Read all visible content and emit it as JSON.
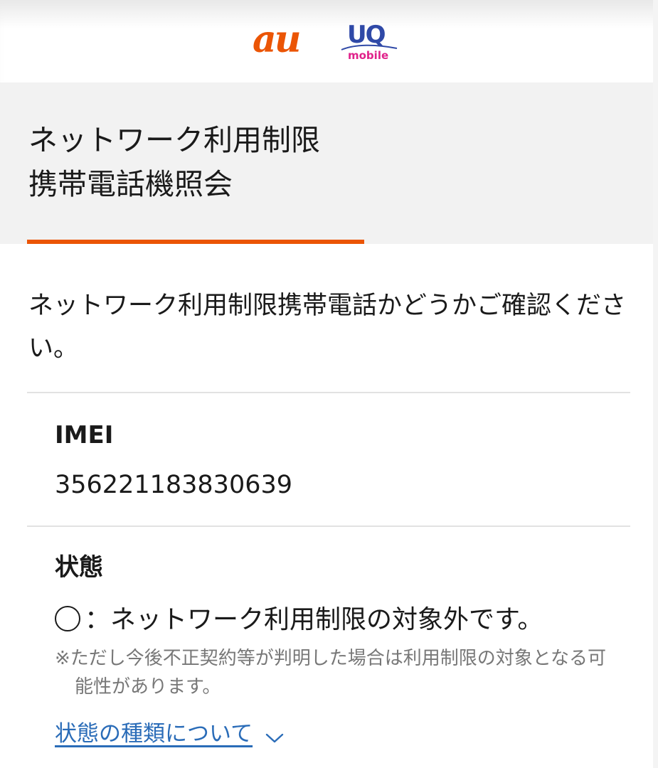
{
  "header": {
    "logo_au": "au",
    "logo_uq": "UQ",
    "logo_uq_sub": "mobile"
  },
  "page": {
    "title": "ネットワーク利用制限\n携帯電話機照会",
    "intro": "ネットワーク利用制限携帯電話かどうかご確認ください。"
  },
  "imei": {
    "label": "IMEI",
    "value": "356221183830639"
  },
  "status": {
    "label": "状態",
    "result": "：ネットワーク利用制限の対象外です。",
    "note": "※ただし今後不正契約等が判明した場合は利用制限の対象となる可能性があります。",
    "link": "状態の種類について"
  },
  "colors": {
    "accent": "#eb5505",
    "link": "#2a6cb8",
    "band": "#f2f2f2"
  }
}
